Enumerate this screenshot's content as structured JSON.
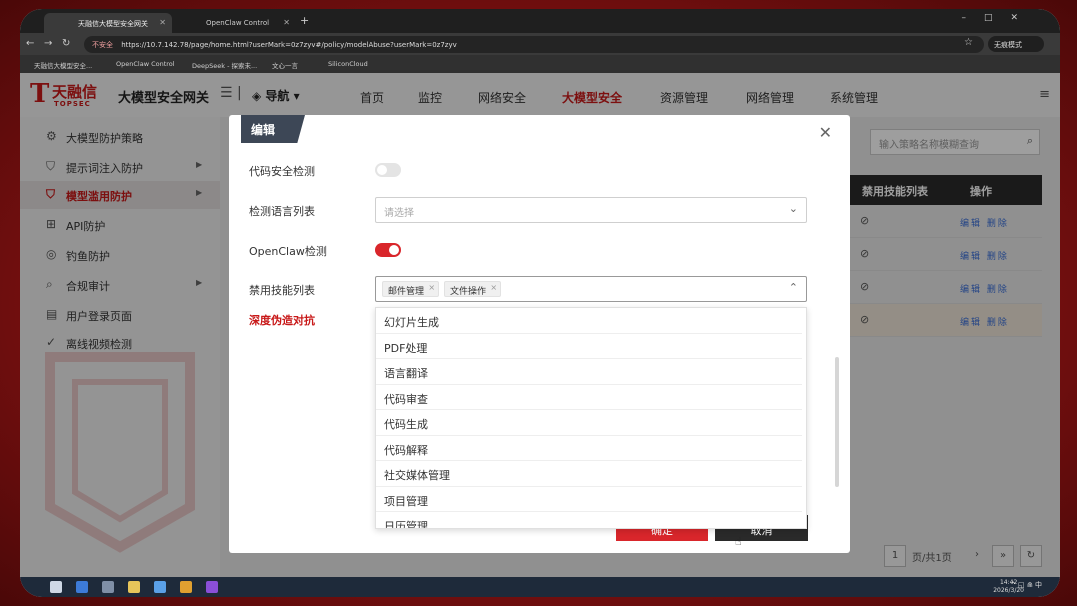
{
  "browser": {
    "tabs": [
      {
        "title": "天融信大模型安全网关",
        "active": true
      },
      {
        "title": "OpenClaw Control",
        "active": false
      }
    ],
    "new_tab": "+",
    "url_insecure": "不安全",
    "url": "https://10.7.142.78/page/home.html?userMark=0z7zyv#/policy/modelAbuse?userMark=0z7zyv",
    "incognito": "无痕模式",
    "bookmarks": [
      "天融信大模型安全...",
      "OpenClaw Control",
      "DeepSeek - 探索未...",
      "文心一言",
      "SiliconCloud"
    ]
  },
  "header": {
    "logo_cn": "天融信",
    "logo_en": "TOPSEC",
    "gateway_name": "大模型安全网关",
    "nav_selector": "导航",
    "nav": [
      "首页",
      "监控",
      "网络安全",
      "大模型安全",
      "资源管理",
      "网络管理",
      "系统管理"
    ],
    "active_nav": "大模型安全"
  },
  "sidebar": {
    "items": [
      {
        "label": "大模型防护策略",
        "icon": "gear-icon",
        "has_arrow": false,
        "active": false
      },
      {
        "label": "提示词注入防护",
        "icon": "shield-icon",
        "has_arrow": true,
        "active": false
      },
      {
        "label": "模型滥用防护",
        "icon": "shield-icon",
        "has_arrow": true,
        "active": true
      },
      {
        "label": "API防护",
        "icon": "api-icon",
        "has_arrow": false,
        "active": false
      },
      {
        "label": "钓鱼防护",
        "icon": "target-icon",
        "has_arrow": false,
        "active": false
      },
      {
        "label": "合规审计",
        "icon": "search-icon",
        "has_arrow": true,
        "active": false
      },
      {
        "label": "用户登录页面",
        "icon": "page-icon",
        "has_arrow": false,
        "active": false
      },
      {
        "label": "离线视频检测",
        "icon": "check-icon",
        "has_arrow": false,
        "active": false
      }
    ]
  },
  "main": {
    "search_placeholder": "输入策略名称模糊查询",
    "table_headers": [
      "禁用技能列表",
      "操作"
    ],
    "row_ops": [
      "编辑",
      "删除"
    ],
    "pager": {
      "page": "1",
      "total": "页/共1页"
    }
  },
  "dialog": {
    "title": "编辑",
    "fields": {
      "code_security_label": "代码安全检测",
      "code_security_on": false,
      "detect_lang_label": "检测语言列表",
      "detect_lang_placeholder": "请选择",
      "openclaw_label": "OpenClaw检测",
      "openclaw_on": true,
      "banned_skills_label": "禁用技能列表",
      "banned_skills_tags": [
        "邮件管理",
        "文件操作"
      ],
      "deepfake_label": "深度伪造对抗"
    },
    "dropdown_options": [
      "幻灯片生成",
      "PDF处理",
      "语言翻译",
      "代码审查",
      "代码生成",
      "代码解释",
      "社交媒体管理",
      "项目管理",
      "日历管理"
    ],
    "ok_label": "确定",
    "cancel_label": "取消"
  },
  "taskbar": {
    "tray": "^ ◱ ⋒ 中",
    "time": "14:42",
    "date": "2026/3/20"
  },
  "colors": {
    "brand": "#c81919",
    "toggle_on": "#d9262b",
    "dialog_title_bg": "#3d4756"
  }
}
